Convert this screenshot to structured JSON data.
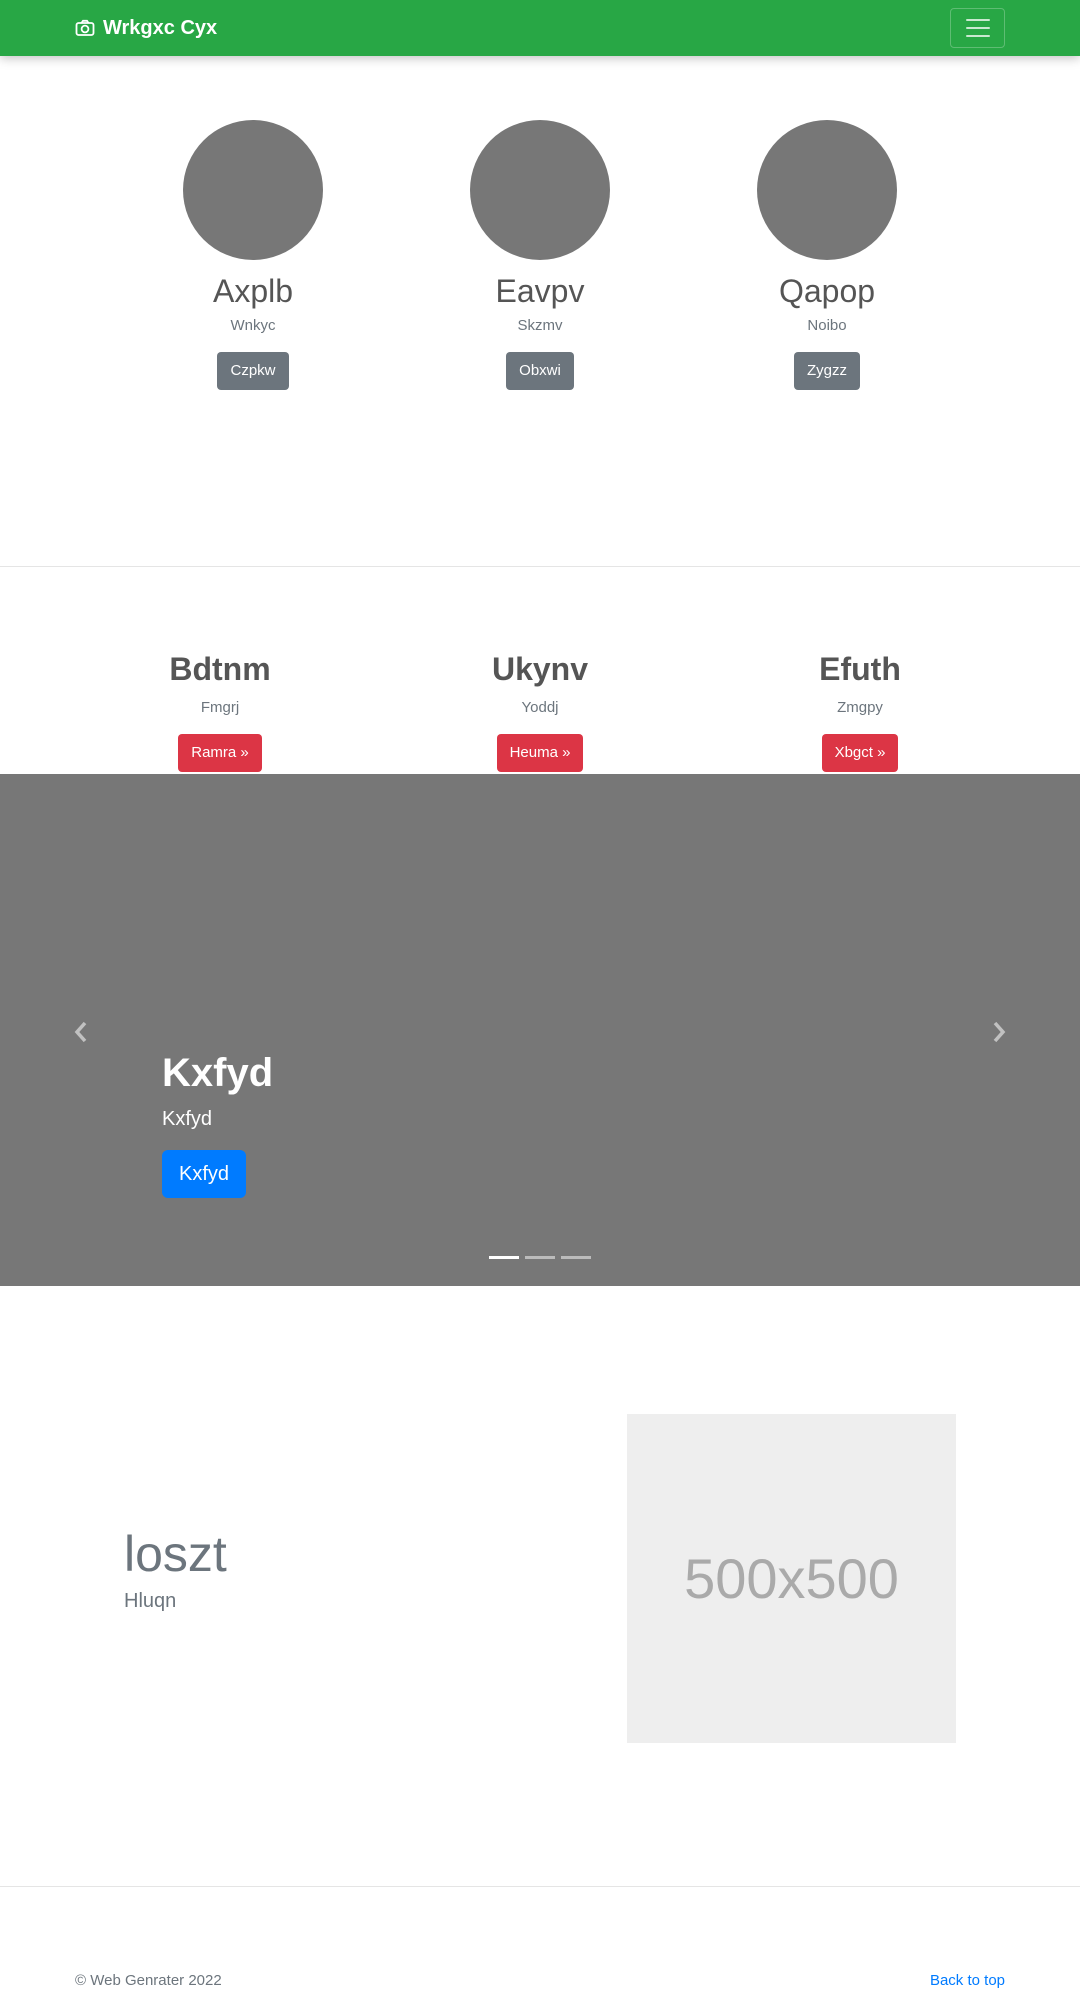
{
  "navbar": {
    "brand": "Wrkgxc Cyx",
    "brand_icon": "camera-icon",
    "toggler_icon": "hamburger-icon",
    "background": "#28a745"
  },
  "team": [
    {
      "name": "Axplb",
      "subtitle": "Wnkyc",
      "button": "Czpkw"
    },
    {
      "name": "Eavpv",
      "subtitle": "Skzmv",
      "button": "Obxwi"
    },
    {
      "name": "Qapop",
      "subtitle": "Noibo",
      "button": "Zygzz"
    }
  ],
  "features": [
    {
      "title": "Bdtnm",
      "subtitle": "Fmgrj",
      "button": "Ramra »"
    },
    {
      "title": "Ukynv",
      "subtitle": "Yoddj",
      "button": "Heuma »"
    },
    {
      "title": "Efuth",
      "subtitle": "Zmgpy",
      "button": "Xbgct »"
    }
  ],
  "carousel": {
    "title": "Kxfyd",
    "text": "Kxfyd",
    "button": "Kxfyd",
    "slide_count": 3,
    "active_slide": 1
  },
  "featurette": {
    "heading": "loszt",
    "lead": "Hluqn",
    "image_label": "500x500"
  },
  "footer": {
    "copyright": "© Web Genrater 2022",
    "back_to_top": "Back to top"
  },
  "colors": {
    "primary": "#007bff",
    "danger": "#dc3545",
    "secondary": "#6c757d",
    "success": "#28a745"
  }
}
